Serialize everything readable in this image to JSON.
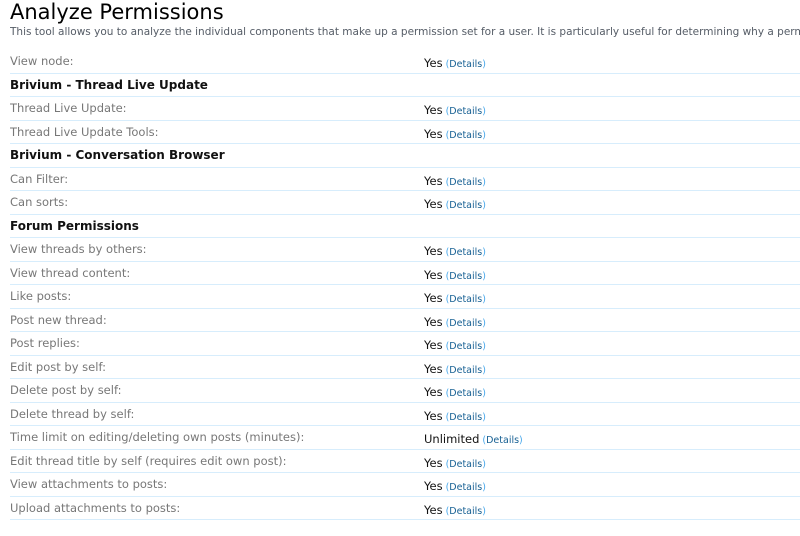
{
  "header": {
    "title": "Analyze Permissions",
    "description": "This tool allows you to analyze the individual components that make up a permission set for a user. It is particularly useful for determining why a permission is not being applied a"
  },
  "details_label": "Details",
  "rows_top": [
    {
      "label": "View node:",
      "value": "Yes"
    }
  ],
  "sections": [
    {
      "title": "Brivium - Thread Live Update",
      "rows": [
        {
          "label": "Thread Live Update:",
          "value": "Yes"
        },
        {
          "label": "Thread Live Update Tools:",
          "value": "Yes"
        }
      ]
    },
    {
      "title": "Brivium - Conversation Browser",
      "rows": [
        {
          "label": "Can Filter:",
          "value": "Yes"
        },
        {
          "label": "Can sorts:",
          "value": "Yes"
        }
      ]
    },
    {
      "title": "Forum Permissions",
      "rows": [
        {
          "label": "View threads by others:",
          "value": "Yes"
        },
        {
          "label": "View thread content:",
          "value": "Yes"
        },
        {
          "label": "Like posts:",
          "value": "Yes"
        },
        {
          "label": "Post new thread:",
          "value": "Yes"
        },
        {
          "label": "Post replies:",
          "value": "Yes"
        },
        {
          "label": "Edit post by self:",
          "value": "Yes"
        },
        {
          "label": "Delete post by self:",
          "value": "Yes"
        },
        {
          "label": "Delete thread by self:",
          "value": "Yes"
        },
        {
          "label": "Time limit on editing/deleting own posts (minutes):",
          "value": "Unlimited"
        },
        {
          "label": "Edit thread title by self (requires edit own post):",
          "value": "Yes"
        },
        {
          "label": "View attachments to posts:",
          "value": "Yes"
        },
        {
          "label": "Upload attachments to posts:",
          "value": "Yes"
        }
      ]
    }
  ]
}
